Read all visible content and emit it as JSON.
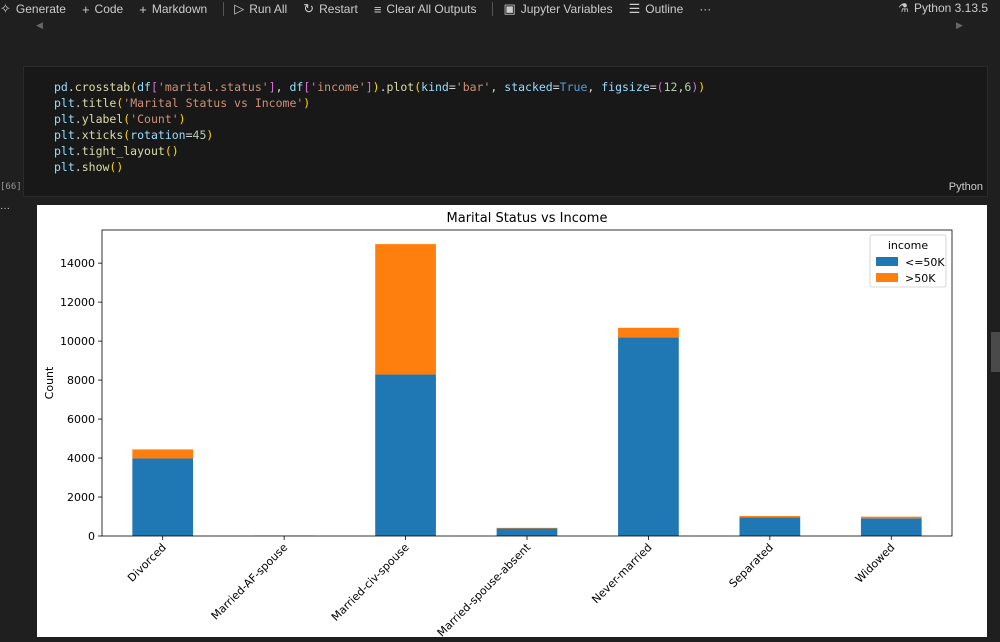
{
  "toolbar": {
    "items": [
      {
        "icon": "sparkle-icon",
        "label": "Generate"
      },
      {
        "icon": "plus-icon",
        "label": "Code"
      },
      {
        "icon": "plus-icon",
        "label": "Markdown"
      },
      {
        "icon": "run-all-icon",
        "label": "Run All"
      },
      {
        "icon": "restart-icon",
        "label": "Restart"
      },
      {
        "icon": "clear-outputs-icon",
        "label": "Clear All Outputs"
      },
      {
        "icon": "variables-icon",
        "label": "Jupyter Variables"
      },
      {
        "icon": "outline-icon",
        "label": "Outline"
      }
    ],
    "more": "···",
    "kernel": "Python 3.13.5"
  },
  "cell": {
    "code_lines": [
      "pd.crosstab(df['marital.status'], df['income']).plot(kind='bar', stacked=True, figsize=(12,6))",
      "plt.title('Marital Status vs Income')",
      "plt.ylabel('Count')",
      "plt.xticks(rotation=45)",
      "plt.tight_layout()",
      "plt.show()"
    ],
    "language": "Python",
    "exec_count": "[66]"
  },
  "chart_data": {
    "type": "bar",
    "stacked": true,
    "title": "Marital Status vs Income",
    "xlabel": "",
    "ylabel": "Count",
    "categories": [
      "Divorced",
      "Married-AF-spouse",
      "Married-civ-spouse",
      "Married-spouse-absent",
      "Never-married",
      "Separated",
      "Widowed"
    ],
    "series": [
      {
        "name": "<=50K",
        "color": "#1f77b4",
        "values": [
          3980,
          13,
          8284,
          384,
          10192,
          959,
          908
        ]
      },
      {
        "name": ">50K",
        "color": "#ff7f0e",
        "values": [
          463,
          10,
          6692,
          34,
          491,
          66,
          85
        ]
      }
    ],
    "ylim": [
      0,
      15700
    ],
    "yticks": [
      0,
      2000,
      4000,
      6000,
      8000,
      10000,
      12000,
      14000
    ],
    "legend": {
      "title": "income",
      "position": "top-right"
    },
    "grid": false
  }
}
